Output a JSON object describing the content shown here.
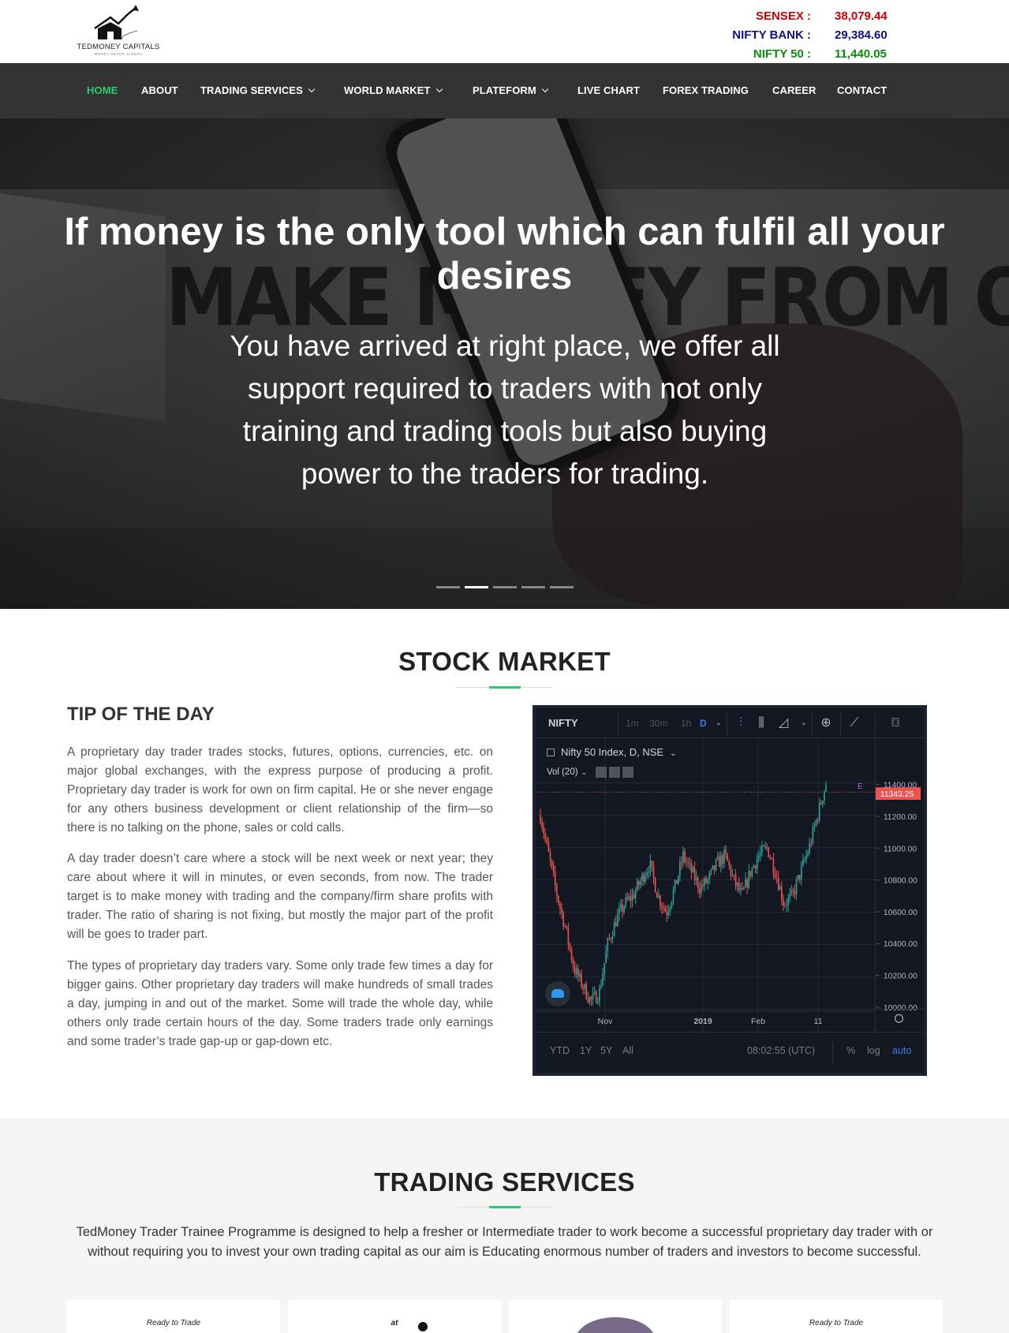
{
  "header": {
    "logo": {
      "name": "TEDMONEY CAPITALS",
      "tagline": "MONEY NEVER SLEEPS"
    },
    "ticker": [
      {
        "label": "SENSEX :",
        "value": "38,079.44",
        "color": "#cc0000"
      },
      {
        "label": "NIFTY BANK :",
        "value": "29,384.60",
        "color": "#10108c"
      },
      {
        "label": "NIFTY 50 :",
        "value": "11,440.05",
        "color": "#0a8a0a"
      }
    ]
  },
  "nav": {
    "items": [
      {
        "label": "HOME",
        "active": true,
        "dropdown": false
      },
      {
        "label": "ABOUT",
        "active": false,
        "dropdown": false
      },
      {
        "label": "TRADING SERVICES",
        "active": false,
        "dropdown": true
      },
      {
        "label": "WORLD MARKET",
        "active": false,
        "dropdown": true
      },
      {
        "label": "PLATEFORM",
        "active": false,
        "dropdown": true
      },
      {
        "label": "LIVE CHART",
        "active": false,
        "dropdown": false
      },
      {
        "label": "FOREX TRADING",
        "active": false,
        "dropdown": false
      },
      {
        "label": "CAREER",
        "active": false,
        "dropdown": false
      },
      {
        "label": "CONTACT",
        "active": false,
        "dropdown": false
      }
    ],
    "active_color": "#2ecc71"
  },
  "hero": {
    "background_text": "MAKE MONEY FROM ONLINE TRADING",
    "title": "If money is the only tool which can fulfil all your desires",
    "subtitle": "You have arrived at right place, we offer all support required to traders with not only training and trading tools but also buying power to the traders for trading.",
    "slides": 5,
    "active_slide": 2
  },
  "stock_market": {
    "title": "STOCK MARKET",
    "tip_title": "TIP OF THE DAY",
    "paragraphs": [
      "A proprietary day trader trades stocks, futures, options, currencies, etc. on major global exchanges, with the express purpose of producing a profit. Proprietary day trader is work for own on firm capital. He or she never engage for any others business development or client relationship of the firm—so there is no talking on the phone, sales or cold calls.",
      "A day trader doesn’t care where a stock will be next week or next year; they care about where it will in minutes, or even seconds, from now. The trader target is to make money with trading and the company/firm share profits with trader. The ratio of sharing is not fixing, but mostly the major part of the profit will be goes to trader part.",
      "The types of proprietary day traders vary. Some only trade few times a day for bigger gains. Other proprietary day traders will make hundreds of small trades a day, jumping in and out of the market. Some will trade the whole day, while others only trade certain hours of the day. Some traders trade only earnings and some trader’s trade gap-up or gap-down etc."
    ]
  },
  "chart_widget": {
    "symbol": "NIFTY",
    "timeframes": [
      "1m",
      "30m",
      "1h",
      "D"
    ],
    "active_timeframe": "D",
    "legend": "Nifty 50 Index, D, NSE",
    "volume_label": "Vol (20)",
    "marker": "E",
    "price_tag": "11343.25",
    "time": "08:02:55 (UTC)",
    "ranges": [
      "YTD",
      "1Y",
      "5Y",
      "All"
    ],
    "scale_options": [
      "%",
      "log",
      "auto"
    ],
    "colors": {
      "up": "#26a69a",
      "down": "#ef5350",
      "background": "#131722",
      "price_tag": "#ef5350"
    }
  },
  "chart_data": {
    "type": "candlestick",
    "title": "Nifty 50 Index, D, NSE",
    "x_ticks": [
      "Nov",
      "2019",
      "Feb",
      "11"
    ],
    "y_ticks": [
      "11400.00",
      "11200.00",
      "11000.00",
      "10800.00",
      "10600.00",
      "10400.00",
      "10200.00",
      "10000.00"
    ],
    "ylim": [
      9900,
      11520
    ],
    "last_price": 11343.25,
    "close_path": [
      11200,
      10950,
      10700,
      10500,
      10250,
      10150,
      10050,
      10100,
      10400,
      10550,
      10650,
      10700,
      10800,
      10900,
      10700,
      10600,
      10750,
      10950,
      10850,
      10750,
      10800,
      10900,
      10950,
      10800,
      10700,
      10850,
      10950,
      11000,
      10850,
      10650,
      10700,
      10850,
      11000,
      11200,
      11400
    ]
  },
  "trading_services": {
    "title": "TRADING SERVICES",
    "description": "TedMoney Trader Trainee Programme is designed to help a fresher or Intermediate trader to work become a successful proprietary day trader with or without requiring you to invest your own trading capital as our aim is Educating enormous number of traders and investors to become successful.",
    "cards": [
      {
        "text": "Ready to Trade"
      },
      {
        "text": "at"
      },
      {
        "text": ""
      },
      {
        "text": "Ready to Trade"
      }
    ]
  }
}
